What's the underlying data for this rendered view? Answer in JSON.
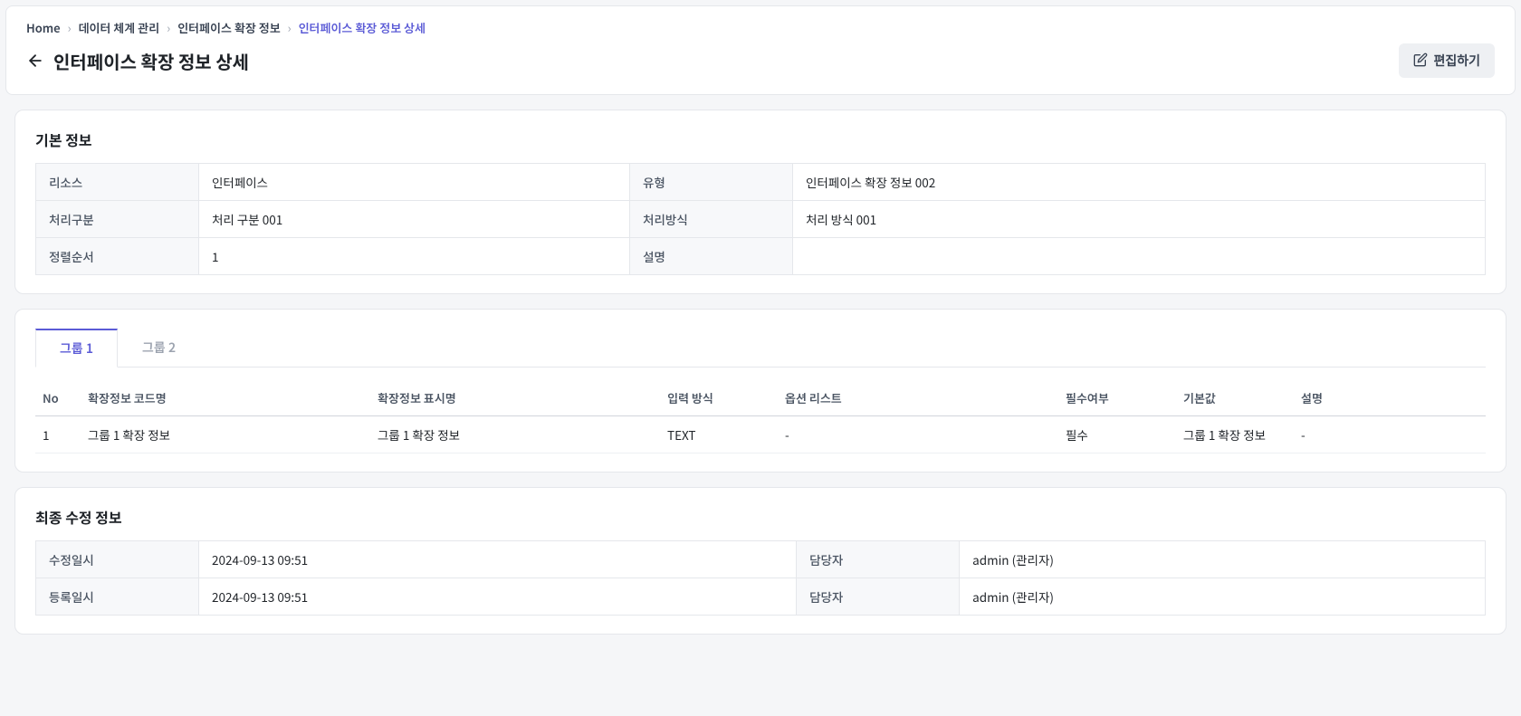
{
  "breadcrumb": {
    "items": [
      {
        "label": "Home",
        "active": false
      },
      {
        "label": "데이터 체계 관리",
        "active": false
      },
      {
        "label": "인터페이스 확장 정보",
        "active": false
      },
      {
        "label": "인터페이스 확장 정보 상세",
        "active": true
      }
    ]
  },
  "header": {
    "title": "인터페이스 확장 정보 상세",
    "edit_label": "편집하기"
  },
  "sections": {
    "basic": {
      "title": "기본 정보",
      "rows": [
        {
          "label1": "리소스",
          "value1": "인터페이스",
          "label2": "유형",
          "value2": "인터페이스 확장 정보 002"
        },
        {
          "label1": "처리구분",
          "value1": "처리 구분 001",
          "label2": "처리방식",
          "value2": "처리 방식 001"
        },
        {
          "label1": "정렬순서",
          "value1": "1",
          "label2": "설명",
          "value2": ""
        }
      ]
    },
    "groups": {
      "tabs": [
        {
          "label": "그룹 1",
          "active": true
        },
        {
          "label": "그룹 2",
          "active": false
        }
      ],
      "columns": {
        "no": "No",
        "code": "확장정보 코드명",
        "display": "확장정보 표시명",
        "input": "입력 방식",
        "options": "옵션 리스트",
        "required": "필수여부",
        "default": "기본값",
        "desc": "설명"
      },
      "rows": [
        {
          "no": "1",
          "code": "그룹 1 확장 정보",
          "display": "그룹 1 확장 정보",
          "input": "TEXT",
          "options": "-",
          "required": "필수",
          "default": "그룹 1 확장 정보",
          "desc": "-"
        }
      ]
    },
    "audit": {
      "title": "최종 수정 정보",
      "rows": [
        {
          "label1": "수정일시",
          "value1": "2024-09-13 09:51",
          "label2": "담당자",
          "value2": "admin (관리자)"
        },
        {
          "label1": "등록일시",
          "value1": "2024-09-13 09:51",
          "label2": "담당자",
          "value2": "admin (관리자)"
        }
      ]
    }
  }
}
